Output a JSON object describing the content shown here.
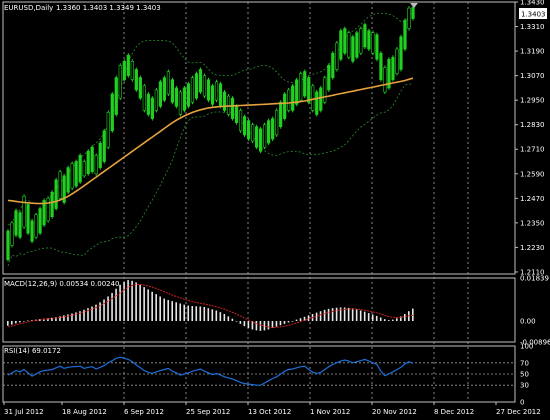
{
  "chart_data": [
    {
      "type": "candlestick",
      "title": "EURUSD,Daily",
      "ohlc_header": "1.3360 1.3403 1.3349 1.3403",
      "last_price_label": "1.3403",
      "ylim": [
        1.21,
        1.343
      ],
      "y_ticks": [
        "1.3430",
        "1.3310",
        "1.3190",
        "1.3070",
        "1.2950",
        "1.2830",
        "1.2710",
        "1.2590",
        "1.2470",
        "1.2350",
        "1.2230",
        "1.2110"
      ],
      "x_ticks": [
        "31 Jul 2012",
        "18 Aug 2012",
        "6 Sep 2012",
        "25 Sep 2012",
        "13 Oct 2012",
        "1 Nov 2012",
        "20 Nov 2012",
        "8 Dec 2012",
        "27 Dec 2012"
      ],
      "grid": true,
      "candles": [
        [
          1.217,
          1.231
        ],
        [
          1.224,
          1.235
        ],
        [
          1.229,
          1.241
        ],
        [
          1.228,
          1.24
        ],
        [
          1.233,
          1.248
        ],
        [
          1.23,
          1.244
        ],
        [
          1.226,
          1.236
        ],
        [
          1.228,
          1.239
        ],
        [
          1.23,
          1.242
        ],
        [
          1.234,
          1.246
        ],
        [
          1.236,
          1.247
        ],
        [
          1.238,
          1.25
        ],
        [
          1.242,
          1.256
        ],
        [
          1.247,
          1.26
        ],
        [
          1.245,
          1.258
        ],
        [
          1.25,
          1.262
        ],
        [
          1.252,
          1.264
        ],
        [
          1.253,
          1.265
        ],
        [
          1.255,
          1.268
        ],
        [
          1.258,
          1.265
        ],
        [
          1.259,
          1.27
        ],
        [
          1.26,
          1.272
        ],
        [
          1.259,
          1.268
        ],
        [
          1.262,
          1.274
        ],
        [
          1.265,
          1.28
        ],
        [
          1.272,
          1.289
        ],
        [
          1.28,
          1.298
        ],
        [
          1.288,
          1.306
        ],
        [
          1.296,
          1.312
        ],
        [
          1.305,
          1.314
        ],
        [
          1.307,
          1.317
        ],
        [
          1.305,
          1.314
        ],
        [
          1.3,
          1.31
        ],
        [
          1.296,
          1.306
        ],
        [
          1.29,
          1.302
        ],
        [
          1.288,
          1.298
        ],
        [
          1.286,
          1.296
        ],
        [
          1.29,
          1.3
        ],
        [
          1.292,
          1.304
        ],
        [
          1.295,
          1.306
        ],
        [
          1.298,
          1.309
        ],
        [
          1.294,
          1.305
        ],
        [
          1.292,
          1.301
        ],
        [
          1.288,
          1.299
        ],
        [
          1.29,
          1.301
        ],
        [
          1.292,
          1.303
        ],
        [
          1.294,
          1.306
        ],
        [
          1.296,
          1.308
        ],
        [
          1.299,
          1.31
        ],
        [
          1.297,
          1.307
        ],
        [
          1.295,
          1.305
        ],
        [
          1.293,
          1.302
        ],
        [
          1.295,
          1.304
        ],
        [
          1.292,
          1.303
        ],
        [
          1.29,
          1.299
        ],
        [
          1.288,
          1.297
        ],
        [
          1.286,
          1.296
        ],
        [
          1.284,
          1.292
        ],
        [
          1.28,
          1.29
        ],
        [
          1.278,
          1.287
        ],
        [
          1.276,
          1.285
        ],
        [
          1.275,
          1.283
        ],
        [
          1.272,
          1.282
        ],
        [
          1.27,
          1.281
        ],
        [
          1.272,
          1.283
        ],
        [
          1.274,
          1.285
        ],
        [
          1.276,
          1.286
        ],
        [
          1.278,
          1.29
        ],
        [
          1.282,
          1.294
        ],
        [
          1.286,
          1.298
        ],
        [
          1.29,
          1.3
        ],
        [
          1.29,
          1.302
        ],
        [
          1.293,
          1.305
        ],
        [
          1.295,
          1.308
        ],
        [
          1.297,
          1.309
        ],
        [
          1.294,
          1.306
        ],
        [
          1.29,
          1.302
        ],
        [
          1.288,
          1.299
        ],
        [
          1.29,
          1.301
        ],
        [
          1.294,
          1.306
        ],
        [
          1.3,
          1.312
        ],
        [
          1.306,
          1.318
        ],
        [
          1.31,
          1.323
        ],
        [
          1.315,
          1.329
        ],
        [
          1.318,
          1.33
        ],
        [
          1.316,
          1.328
        ],
        [
          1.314,
          1.326
        ],
        [
          1.316,
          1.328
        ],
        [
          1.318,
          1.33
        ],
        [
          1.321,
          1.332
        ],
        [
          1.32,
          1.329
        ],
        [
          1.318,
          1.328
        ],
        [
          1.315,
          1.327
        ],
        [
          1.305,
          1.318
        ],
        [
          1.299,
          1.311
        ],
        [
          1.301,
          1.315
        ],
        [
          1.305,
          1.316
        ],
        [
          1.308,
          1.32
        ],
        [
          1.31,
          1.326
        ],
        [
          1.32,
          1.334
        ],
        [
          1.33,
          1.34
        ],
        [
          1.3349,
          1.3403
        ]
      ],
      "moving_average": [
        1.246,
        1.2458,
        1.2455,
        1.2452,
        1.245,
        1.2448,
        1.2446,
        1.2445,
        1.2444,
        1.2445,
        1.2447,
        1.245,
        1.2455,
        1.2462,
        1.247,
        1.248,
        1.2492,
        1.2505,
        1.2518,
        1.2532,
        1.2546,
        1.256,
        1.2574,
        1.2588,
        1.2602,
        1.2616,
        1.263,
        1.2644,
        1.2658,
        1.2672,
        1.2686,
        1.27,
        1.2714,
        1.2728,
        1.2742,
        1.2756,
        1.277,
        1.2784,
        1.2798,
        1.2812,
        1.2826,
        1.284,
        1.2852,
        1.2863,
        1.2873,
        1.2882,
        1.289,
        1.2897,
        1.2903,
        1.2908,
        1.2912,
        1.2915,
        1.2917,
        1.2919,
        1.292,
        1.2921,
        1.2922,
        1.2923,
        1.2924,
        1.2925,
        1.2926,
        1.2927,
        1.2928,
        1.2929,
        1.293,
        1.2931,
        1.2932,
        1.2933,
        1.2934,
        1.2935,
        1.2936,
        1.2938,
        1.294,
        1.2943,
        1.2946,
        1.295,
        1.2954,
        1.2958,
        1.2962,
        1.2966,
        1.297,
        1.2974,
        1.2978,
        1.2982,
        1.2986,
        1.299,
        1.2994,
        1.2998,
        1.3002,
        1.3006,
        1.301,
        1.3014,
        1.3018,
        1.3022,
        1.3026,
        1.303,
        1.3034,
        1.3038,
        1.3042,
        1.3046,
        1.3052,
        1.3058
      ]
    },
    {
      "type": "bar",
      "title": "MACD(12,26,9) 0.00534 0.00240",
      "y_ticks": [
        "0.01839",
        "0.00",
        "-0.00896"
      ],
      "ylim": [
        -0.00896,
        0.01839
      ],
      "macd": [
        -0.002,
        -0.0015,
        -0.001,
        -0.0006,
        -0.0002,
        0.0002,
        0.0004,
        0.0006,
        0.0008,
        0.001,
        0.0012,
        0.0014,
        0.0017,
        0.002,
        0.0024,
        0.0028,
        0.0032,
        0.0037,
        0.0042,
        0.0048,
        0.0055,
        0.0062,
        0.007,
        0.008,
        0.0092,
        0.0105,
        0.012,
        0.0138,
        0.0155,
        0.0168,
        0.0175,
        0.0172,
        0.0165,
        0.0155,
        0.0145,
        0.0135,
        0.0125,
        0.0115,
        0.0105,
        0.0096,
        0.009,
        0.0085,
        0.008,
        0.0075,
        0.007,
        0.0066,
        0.0064,
        0.0063,
        0.0062,
        0.006,
        0.0055,
        0.005,
        0.0045,
        0.0038,
        0.003,
        0.002,
        0.001,
        -0.0002,
        -0.0012,
        -0.0022,
        -0.003,
        -0.0036,
        -0.004,
        -0.0042,
        -0.004,
        -0.0036,
        -0.003,
        -0.0024,
        -0.0018,
        -0.0012,
        -0.0006,
        0.0,
        0.0006,
        0.0012,
        0.0018,
        0.0024,
        0.003,
        0.0036,
        0.0042,
        0.0048,
        0.0052,
        0.0055,
        0.0057,
        0.0058,
        0.0058,
        0.0056,
        0.0054,
        0.005,
        0.0045,
        0.004,
        0.0034,
        0.0028,
        0.0022,
        0.0015,
        0.0008,
        0.0004,
        0.0006,
        0.0012,
        0.002,
        0.003,
        0.0042,
        0.0053
      ],
      "signal": [
        -0.0025,
        -0.0021,
        -0.0017,
        -0.0012,
        -0.0008,
        -0.0004,
        0.0,
        0.0003,
        0.0005,
        0.0007,
        0.0009,
        0.0011,
        0.0013,
        0.0015,
        0.0018,
        0.0021,
        0.0025,
        0.0029,
        0.0034,
        0.0039,
        0.0045,
        0.0051,
        0.0058,
        0.0066,
        0.0075,
        0.0085,
        0.0096,
        0.0108,
        0.0121,
        0.0134,
        0.0145,
        0.0152,
        0.0156,
        0.0156,
        0.0154,
        0.015,
        0.0145,
        0.0139,
        0.0132,
        0.0125,
        0.0118,
        0.0111,
        0.0105,
        0.0099,
        0.0093,
        0.0088,
        0.0083,
        0.0079,
        0.0076,
        0.0073,
        0.0069,
        0.0065,
        0.0061,
        0.0056,
        0.005,
        0.0044,
        0.0037,
        0.0029,
        0.0021,
        0.0012,
        0.0004,
        -0.0004,
        -0.0011,
        -0.0017,
        -0.0022,
        -0.0025,
        -0.0027,
        -0.0027,
        -0.0025,
        -0.0022,
        -0.0018,
        -0.0013,
        -0.0008,
        -0.0003,
        0.0003,
        0.0009,
        0.0015,
        0.0021,
        0.0027,
        0.0032,
        0.0037,
        0.0041,
        0.0045,
        0.0048,
        0.005,
        0.0051,
        0.0052,
        0.0051,
        0.0049,
        0.0046,
        0.0043,
        0.0039,
        0.0035,
        0.003,
        0.0024,
        0.0019,
        0.0016,
        0.0015,
        0.0016,
        0.0019,
        0.0023,
        0.0024
      ]
    },
    {
      "type": "line",
      "title": "RSI(14) 69.0172",
      "y_ticks": [
        "100",
        "70",
        "50",
        "30",
        "0"
      ],
      "ylim": [
        0,
        100
      ],
      "values": [
        48,
        52,
        56,
        54,
        58,
        52,
        46,
        50,
        54,
        56,
        57,
        58,
        61,
        64,
        60,
        62,
        63,
        63,
        64,
        60,
        62,
        63,
        59,
        62,
        65,
        70,
        74,
        78,
        80,
        78,
        76,
        72,
        66,
        61,
        56,
        53,
        51,
        54,
        56,
        58,
        60,
        55,
        52,
        48,
        50,
        52,
        55,
        57,
        59,
        55,
        52,
        49,
        51,
        48,
        45,
        43,
        41,
        38,
        35,
        33,
        32,
        31,
        30,
        30,
        34,
        38,
        42,
        45,
        50,
        55,
        58,
        59,
        61,
        63,
        64,
        58,
        53,
        51,
        53,
        58,
        63,
        67,
        70,
        73,
        75,
        73,
        70,
        72,
        74,
        76,
        73,
        70,
        67,
        55,
        47,
        50,
        54,
        58,
        62,
        68,
        72,
        69
      ]
    }
  ]
}
